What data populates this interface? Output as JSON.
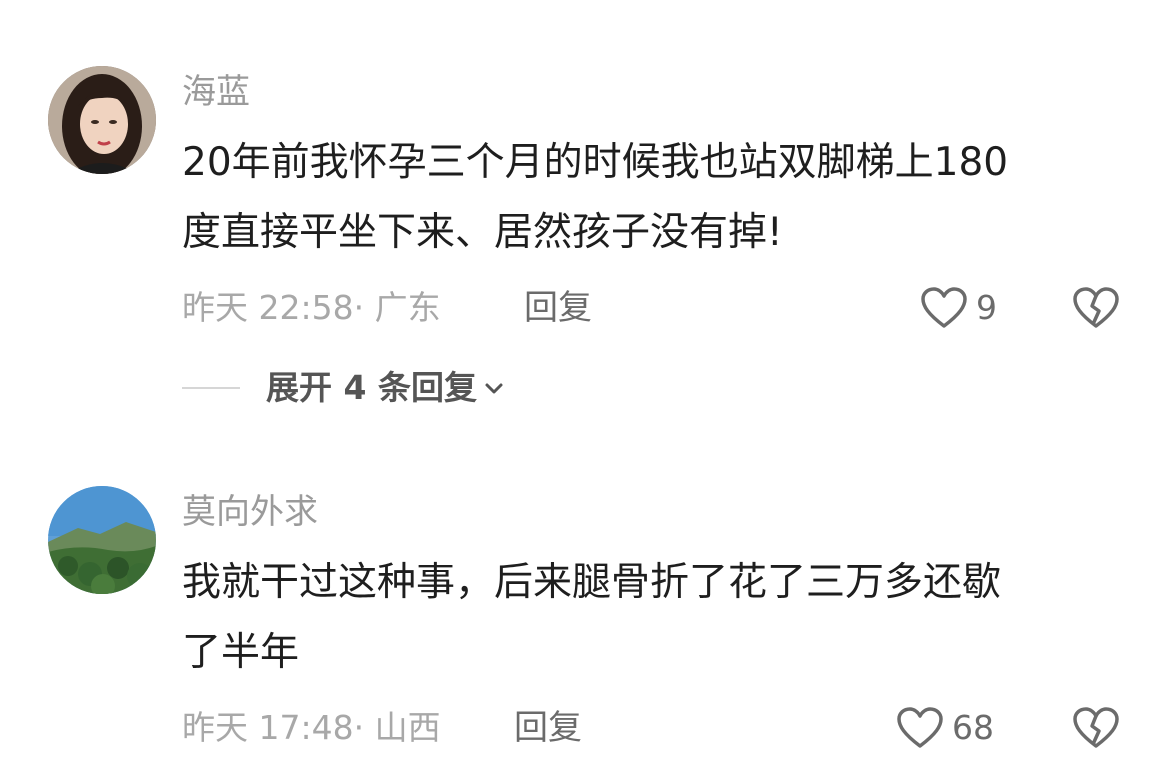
{
  "comments": [
    {
      "username": "海蓝",
      "text_line1": "20年前我怀孕三个月的时候我也站双脚梯上180",
      "text_line2": "度直接平坐下来、居然孩子没有掉!",
      "time": "昨天 22:58",
      "separator": "·",
      "location": "广东",
      "reply_label": "回复",
      "likes": "9",
      "expand_label": "展开 4 条回复",
      "avatar_icon": "woman-portrait-avatar"
    },
    {
      "username": "莫向外求",
      "text_line1": "我就干过这种事，后来腿骨折了花了三万多还歇",
      "text_line2": "了半年",
      "time": "昨天 17:48",
      "separator": "·",
      "location": "山西",
      "reply_label": "回复",
      "likes": "68",
      "avatar_icon": "mountain-landscape-avatar"
    }
  ],
  "icons": {
    "like": "heart-outline-icon",
    "dislike": "broken-heart-icon",
    "expand": "chevron-down-icon"
  },
  "colors": {
    "primary_text": "#1e1e1e",
    "secondary_text": "#9a9a9a",
    "action_text": "#6b6b6b"
  }
}
